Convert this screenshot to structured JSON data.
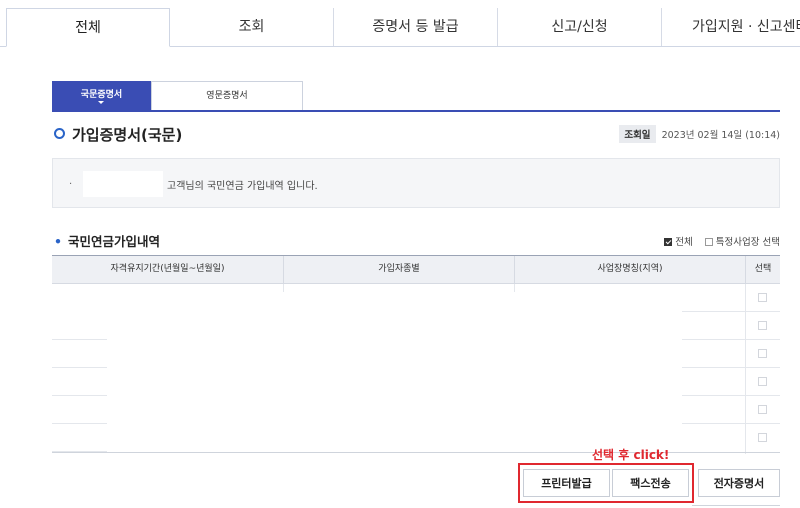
{
  "top_nav": {
    "tabs": [
      "전체",
      "조회",
      "증명서 등 발급",
      "신고/신청",
      "가입지원 · 신고센터"
    ],
    "active_index": 0
  },
  "sub_tabs": {
    "korean": "국문증명서",
    "english": "영문증명서",
    "active": "korean"
  },
  "section": {
    "title": "가입증명서(국문)",
    "lookup_label": "조회일",
    "lookup_date": "2023년 02월 14일 (10:14)"
  },
  "info": {
    "bullet": "·",
    "message": "고객님의 국민연금 가입내역 입니다."
  },
  "history": {
    "title": "국민연금가입내역",
    "filter_all": "전체",
    "filter_all_checked": true,
    "filter_specific": "특정사업장 선택",
    "filter_specific_checked": false,
    "columns": [
      "자격유지기간(년월일~년월일)",
      "가입자종별",
      "사업장명칭(지역)",
      "선택"
    ],
    "row_count": 6
  },
  "hint": "선택 후 click!",
  "buttons": {
    "print": "프린터발급",
    "fax": "팩스전송",
    "electronic": "전자증명서"
  },
  "colors": {
    "accent": "#3a4db4",
    "ring": "#2a64c8",
    "highlight": "#e0282f"
  }
}
